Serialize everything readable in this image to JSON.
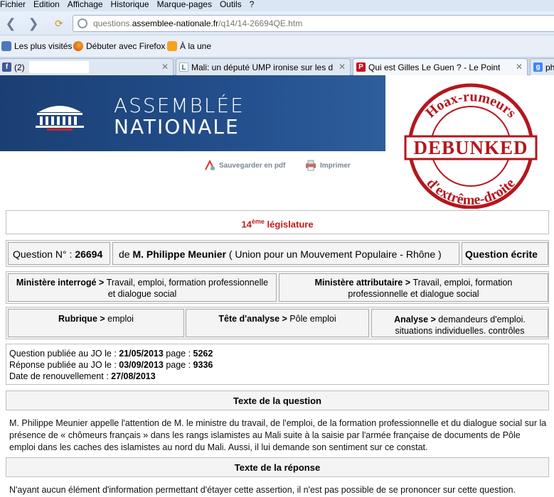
{
  "browser": {
    "menu": [
      "Fichier",
      "Edition",
      "Affichage",
      "Historique",
      "Marque-pages",
      "Outils",
      "?"
    ],
    "url_host": "questions.",
    "url_domain": "assemblee-nationale.fr",
    "url_path": "/q14/14-26694QE.htm",
    "bookmarks": [
      "Les plus visités",
      "Débuter avec Firefox",
      "À la une"
    ],
    "tabs": [
      {
        "icon": "f",
        "label": "(2)"
      },
      {
        "icon": "L",
        "label": "Mali: un député UMP ironise sur les d..."
      },
      {
        "icon": "P",
        "label": "Qui est Gilles Le Guen ? - Le Point"
      },
      {
        "icon": "g",
        "label": "ph"
      }
    ]
  },
  "site": {
    "name_line1": "ASSEMBLÉE",
    "name_line2": "NATIONALE",
    "save_pdf": "Sauvegarder en pdf",
    "print": "Imprimer"
  },
  "stamp": {
    "top_text": "Hoax-rumeurs",
    "middle_text": "DEBUNKED",
    "bottom_text": "d'extrême-droite"
  },
  "question": {
    "legislature_num": "14",
    "legislature_sup": "ème",
    "legislature_word": " législature",
    "number_label": "Question N° : ",
    "number": "26694",
    "de": "de ",
    "deputy": "M. Philippe Meunier",
    "group": " ( Union pour un Mouvement Populaire - Rhône )",
    "type": "Question écrite",
    "ministere_interroge_label": "Ministère interrogé > ",
    "ministere_interroge": "Travail, emploi, formation professionnelle et dialogue social",
    "ministere_attributaire_label": "Ministère attributaire > ",
    "ministere_attributaire": "Travail, emploi, formation professionnelle et dialogue social",
    "rubrique_label": "Rubrique > ",
    "rubrique": "emploi",
    "tete_label": "Tête d'analyse > ",
    "tete": "Pôle emploi",
    "analyse_label": "Analyse > ",
    "analyse": "demandeurs d'emploi. situations individuelles. contrôles",
    "pub_q_label": "Question publiée au JO le : ",
    "pub_q_date": "21/05/2013",
    "pub_q_page_label": " page : ",
    "pub_q_page": "5262",
    "pub_r_label": "Réponse publiée au JO le : ",
    "pub_r_date": "03/09/2013",
    "pub_r_page_label": " page : ",
    "pub_r_page": "9336",
    "renouv_label": "Date de renouvellement : ",
    "renouv_date": "27/08/2013",
    "texte_question_title": "Texte de la question",
    "texte_question": "M. Philippe Meunier appelle l'attention de M. le ministre du travail, de l'emploi, de la formation professionnelle et du dialogue social sur la présence de « chômeurs français » dans les rangs islamistes au Mali suite à la saisie par l'armée française de documents de Pôle emploi dans les caches des islamistes au nord du Mali. Aussi, il lui demande son sentiment sur ce constat.",
    "texte_reponse_title": "Texte de la réponse",
    "texte_reponse": "N'ayant aucun élément d'information permettant d'étayer cette assertion, il n'est pas possible de se prononcer sur cette question."
  }
}
